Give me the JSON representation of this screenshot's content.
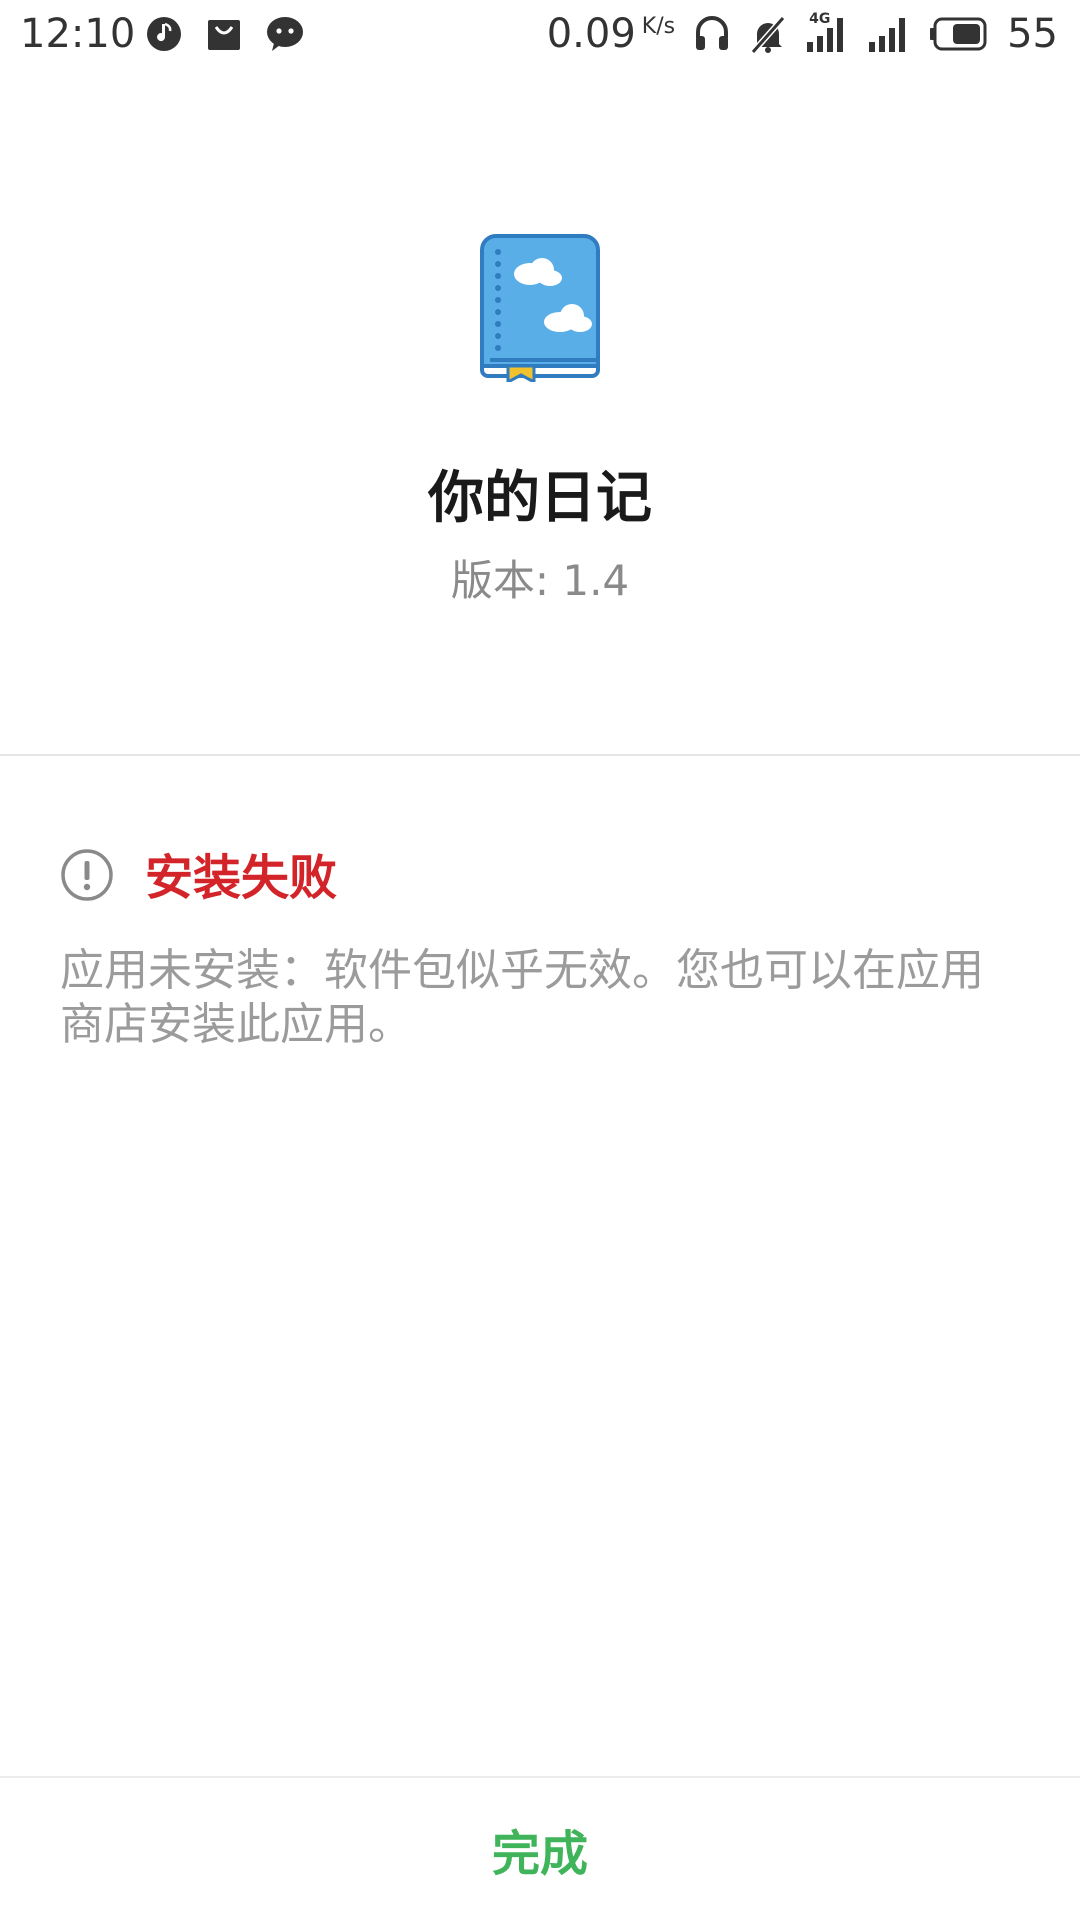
{
  "status_bar": {
    "time": "12:10",
    "net_speed": "0.09",
    "net_speed_unit": "K/s",
    "network_type": "4G",
    "battery_level": "55",
    "left_icons": [
      "music-app-icon",
      "shopping-bag-icon",
      "wechat-icon"
    ],
    "right_icons": [
      "headset-icon",
      "bell-muted-icon",
      "signal-4g-icon",
      "signal-icon",
      "battery-icon"
    ]
  },
  "app": {
    "name": "你的日记",
    "version_label": "版本: 1.4",
    "icon": "diary-book-icon",
    "icon_colors": {
      "cover": "#5aaee8",
      "border": "#2f7cc0",
      "bookmark": "#f2c12e"
    }
  },
  "result": {
    "icon": "alert-circle-icon",
    "title": "安装失败",
    "title_color": "#d3242a",
    "message": "应用未安装：软件包似乎无效。您也可以在应用商店安装此应用。"
  },
  "footer": {
    "done_label": "完成",
    "done_color": "#3fb45a"
  }
}
